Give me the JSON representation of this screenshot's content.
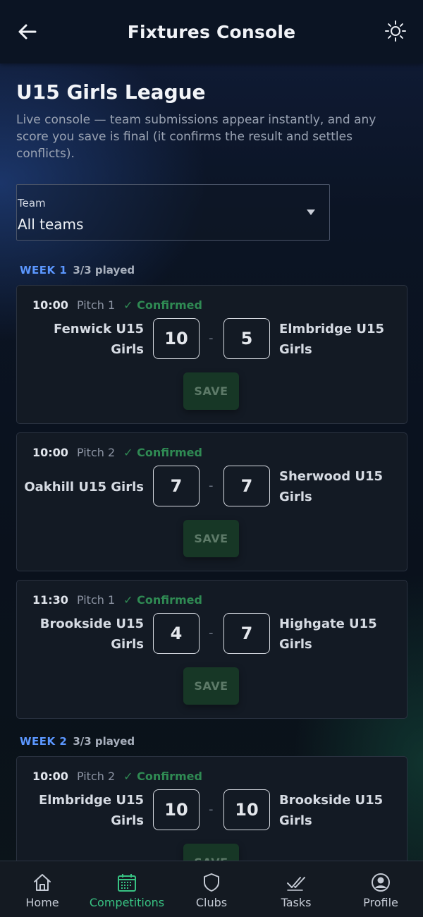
{
  "header": {
    "title": "Fixtures Console"
  },
  "page": {
    "title": "U15 Girls League",
    "subtitle": "Live console — team submissions appear instantly, and any score you save is final (it confirms the result and settles conflicts)."
  },
  "filter": {
    "label": "Team",
    "value": "All teams"
  },
  "weeks": [
    {
      "label": "WEEK 1",
      "played": "3/3 played"
    },
    {
      "label": "WEEK 2",
      "played": "3/3 played"
    }
  ],
  "fixtures": [
    {
      "time": "10:00",
      "pitch": "Pitch 1",
      "status": "✓ Confirmed",
      "home": "Fenwick U15 Girls",
      "away": "Elmbridge U15 Girls",
      "home_score": "10",
      "away_score": "5",
      "save": "SAVE"
    },
    {
      "time": "10:00",
      "pitch": "Pitch 2",
      "status": "✓ Confirmed",
      "home": "Oakhill U15 Girls",
      "away": "Sherwood U15 Girls",
      "home_score": "7",
      "away_score": "7",
      "save": "SAVE"
    },
    {
      "time": "11:30",
      "pitch": "Pitch 1",
      "status": "✓ Confirmed",
      "home": "Brookside U15 Girls",
      "away": "Highgate U15 Girls",
      "home_score": "4",
      "away_score": "7",
      "save": "SAVE"
    },
    {
      "time": "10:00",
      "pitch": "Pitch 2",
      "status": "✓ Confirmed",
      "home": "Elmbridge U15 Girls",
      "away": "Brookside U15 Girls",
      "home_score": "10",
      "away_score": "10",
      "save": "SAVE"
    }
  ],
  "separator": "-",
  "nav": {
    "items": [
      {
        "label": "Home",
        "icon": "home-icon"
      },
      {
        "label": "Competitions",
        "icon": "calendar-icon",
        "active": true
      },
      {
        "label": "Clubs",
        "icon": "shield-icon"
      },
      {
        "label": "Tasks",
        "icon": "double-check-icon"
      },
      {
        "label": "Profile",
        "icon": "user-circle-icon"
      }
    ]
  },
  "colors": {
    "accent_green": "#38c383",
    "week_blue": "#5b97ff",
    "confirmed_green": "#2f8a53",
    "save_bg": "#173726"
  }
}
